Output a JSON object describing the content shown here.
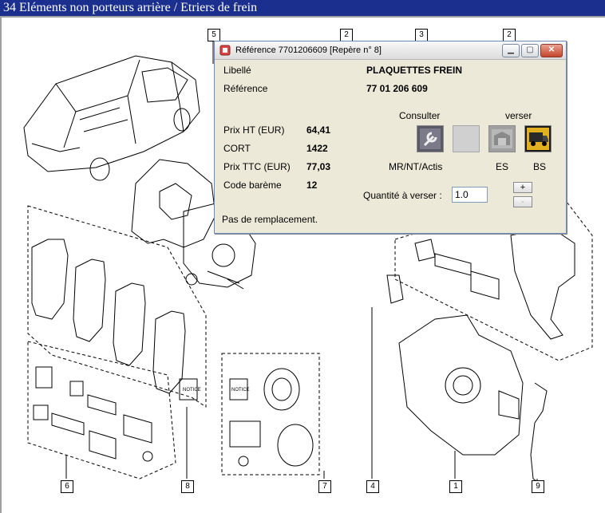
{
  "header": {
    "title": "34 Eléments non porteurs arrière / Etriers de frein"
  },
  "callouts": [
    "5",
    "2",
    "3",
    "2",
    "6",
    "8",
    "7",
    "4",
    "1",
    "9"
  ],
  "drawing_labels": {
    "notice": "NOTICE"
  },
  "dialog": {
    "title": "Référence 7701206609 [Repère n° 8]",
    "libelle_label": "Libellé",
    "libelle_value": "PLAQUETTES FREIN",
    "reference_label": "Référence",
    "reference_value": "77 01 206 609",
    "prix_ht_label": "Prix HT (EUR)",
    "prix_ht_value": "64,41",
    "cort_label": "CORT",
    "cort_value": "1422",
    "prix_ttc_label": "Prix TTC (EUR)",
    "prix_ttc_value": "77,03",
    "code_bareme_label": "Code barème",
    "code_bareme_value": "12",
    "remplacement_text": "Pas de remplacement.",
    "consulter_label": "Consulter",
    "verser_label": "verser",
    "tile_captions": {
      "mr": "MR/NT/Actis",
      "es": "ES",
      "bs": "BS"
    },
    "quantite_label": "Quantité à verser :",
    "quantite_value": "1.0",
    "plus_label": "+",
    "minus_label": "-",
    "icons": [
      "app-icon",
      "minimize-icon",
      "maximize-icon",
      "close-icon",
      "wrench-icon",
      "warehouse-icon",
      "truck-icon"
    ]
  }
}
